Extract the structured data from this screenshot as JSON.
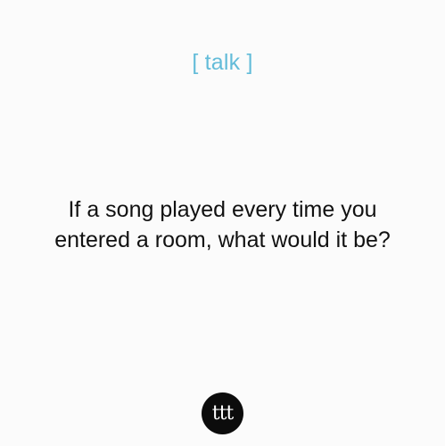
{
  "category": "[ talk ]",
  "question": {
    "line1": "If a song played every time you",
    "line2": "entered a room, what would it be?"
  },
  "logo": {
    "text": "ttt",
    "background": "#0c0c0c"
  },
  "colors": {
    "accent": "#63bcd9",
    "text": "#111111",
    "background": "#fbfbfb"
  }
}
